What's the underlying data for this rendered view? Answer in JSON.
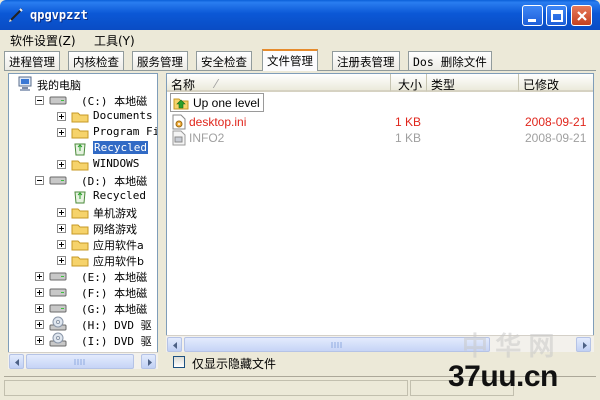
{
  "window": {
    "title": "qpgvpzzt"
  },
  "menu": [
    {
      "label": "软件设置(Z)"
    },
    {
      "label": "工具(Y)"
    }
  ],
  "tabs": [
    {
      "label": "进程管理",
      "active": false
    },
    {
      "label": "内核检查",
      "active": false
    },
    {
      "label": "服务管理",
      "active": false
    },
    {
      "label": "安全检查",
      "active": false
    },
    {
      "label": "文件管理",
      "active": true
    },
    {
      "label": "注册表管理",
      "active": false
    },
    {
      "label": "Dos 删除文件",
      "active": false
    }
  ],
  "tree": {
    "root": "我的电脑",
    "items": [
      {
        "label": "(C:)  本地磁",
        "icon": "drive-icon",
        "expander": "open"
      },
      {
        "label": "Documents",
        "icon": "folder-icon",
        "expander": "closed"
      },
      {
        "label": "Program Fi",
        "icon": "folder-icon",
        "expander": "closed"
      },
      {
        "label": "Recycled",
        "icon": "recycle-icon",
        "expander": "none",
        "selected": true
      },
      {
        "label": "WINDOWS",
        "icon": "folder-icon",
        "expander": "closed"
      },
      {
        "label": "(D:)  本地磁",
        "icon": "drive-icon",
        "expander": "open"
      },
      {
        "label": "Recycled",
        "icon": "recycle-icon",
        "expander": "none"
      },
      {
        "label": "单机游戏",
        "icon": "folder-icon",
        "expander": "closed"
      },
      {
        "label": "网络游戏",
        "icon": "folder-icon",
        "expander": "closed"
      },
      {
        "label": "应用软件a",
        "icon": "folder-icon",
        "expander": "closed"
      },
      {
        "label": "应用软件b",
        "icon": "folder-icon",
        "expander": "closed"
      },
      {
        "label": "(E:)  本地磁",
        "icon": "drive-icon",
        "expander": "closed"
      },
      {
        "label": "(F:)  本地磁",
        "icon": "drive-icon",
        "expander": "closed"
      },
      {
        "label": "(G:)  本地磁",
        "icon": "drive-icon",
        "expander": "closed"
      },
      {
        "label": "(H:)  DVD 驱",
        "icon": "dvd-icon",
        "expander": "closed"
      },
      {
        "label": "(I:)  DVD 驱",
        "icon": "dvd-icon",
        "expander": "closed"
      }
    ]
  },
  "filelist": {
    "columns": [
      "名称",
      "大小",
      "类型",
      "已修改"
    ],
    "up_label": "Up one level",
    "rows": [
      {
        "name": "desktop.ini",
        "size": "1 KB",
        "type": "",
        "modified": "2008-09-21",
        "color": "#e0261c"
      },
      {
        "name": "INFO2",
        "size": "1 KB",
        "type": "",
        "modified": "2008-09-21",
        "color": "#a0a0a0"
      }
    ]
  },
  "options": {
    "show_hidden_label": "仅显示隐藏文件",
    "show_hidden_checked": false
  },
  "watermark": {
    "text": "37uu.cn",
    "ghost": "中 华 网"
  },
  "colors": {
    "titlebar": "#0a58d6",
    "selection": "#316ac5",
    "hidden_file": "#e0261c",
    "system_file": "#a0a0a0",
    "active_tab_accent": "#e68b2c"
  }
}
